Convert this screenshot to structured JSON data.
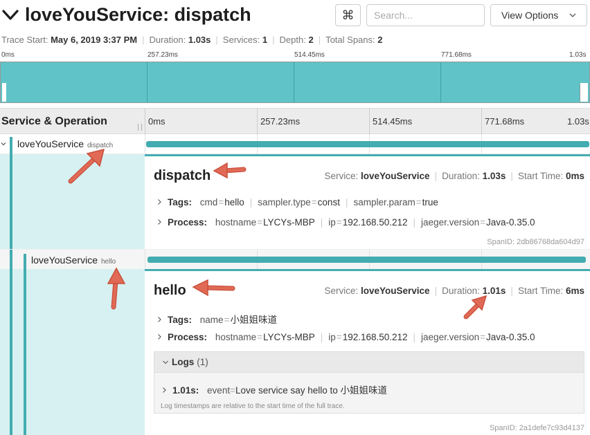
{
  "header": {
    "title": "loveYouService: dispatch",
    "cmd_glyph": "⌘",
    "search_placeholder": "Search...",
    "view_options_label": "View Options"
  },
  "meta": {
    "trace_start_label": "Trace Start:",
    "trace_start_value": "May 6, 2019 3:37 PM",
    "duration_label": "Duration:",
    "duration_value": "1.03s",
    "services_label": "Services:",
    "services_value": "1",
    "depth_label": "Depth:",
    "depth_value": "2",
    "total_spans_label": "Total Spans:",
    "total_spans_value": "2"
  },
  "minimap": {
    "ticks": [
      "0ms",
      "257.23ms",
      "514.45ms",
      "771.68ms",
      "1.03s"
    ]
  },
  "timeline_header": {
    "label": "Service & Operation",
    "ticks": [
      "0ms",
      "257.23ms",
      "514.45ms",
      "771.68ms",
      "1.03s"
    ]
  },
  "spans": [
    {
      "service": "loveYouService",
      "operation": "dispatch",
      "detail": {
        "title": "dispatch",
        "service_label": "Service:",
        "service_value": "loveYouService",
        "duration_label": "Duration:",
        "duration_value": "1.03s",
        "start_label": "Start Time:",
        "start_value": "0ms",
        "tags_label": "Tags:",
        "tags": [
          {
            "k": "cmd",
            "v": "hello"
          },
          {
            "k": "sampler.type",
            "v": "const"
          },
          {
            "k": "sampler.param",
            "v": "true"
          }
        ],
        "process_label": "Process:",
        "process": [
          {
            "k": "hostname",
            "v": "LYCYs-MBP"
          },
          {
            "k": "ip",
            "v": "192.168.50.212"
          },
          {
            "k": "jaeger.version",
            "v": "Java-0.35.0"
          }
        ],
        "span_id_label": "SpanID:",
        "span_id": "2db86768da604d97"
      }
    },
    {
      "service": "loveYouService",
      "operation": "hello",
      "detail": {
        "title": "hello",
        "service_label": "Service:",
        "service_value": "loveYouService",
        "duration_label": "Duration:",
        "duration_value": "1.01s",
        "start_label": "Start Time:",
        "start_value": "6ms",
        "tags_label": "Tags:",
        "tags": [
          {
            "k": "name",
            "v": "小姐姐味道"
          }
        ],
        "process_label": "Process:",
        "process": [
          {
            "k": "hostname",
            "v": "LYCYs-MBP"
          },
          {
            "k": "ip",
            "v": "192.168.50.212"
          },
          {
            "k": "jaeger.version",
            "v": "Java-0.35.0"
          }
        ],
        "logs_label": "Logs",
        "logs_count": "(1)",
        "log_time": "1.01s:",
        "log_fields": [
          {
            "k": "event",
            "v": "Love service say hello to 小姐姐味道"
          }
        ],
        "log_note": "Log timestamps are relative to the start time of the full trace.",
        "span_id_label": "SpanID:",
        "span_id": "2a1defe7c93d4137"
      }
    }
  ],
  "colors": {
    "accent": "#43acb0",
    "minimap_fill": "#5fc3c7",
    "row_fill": "#d7f1f2",
    "annotation_arrow": "#e05a45"
  },
  "icons": {
    "collapse": "chevron-down-icon",
    "expand": "chevron-right-icon"
  }
}
